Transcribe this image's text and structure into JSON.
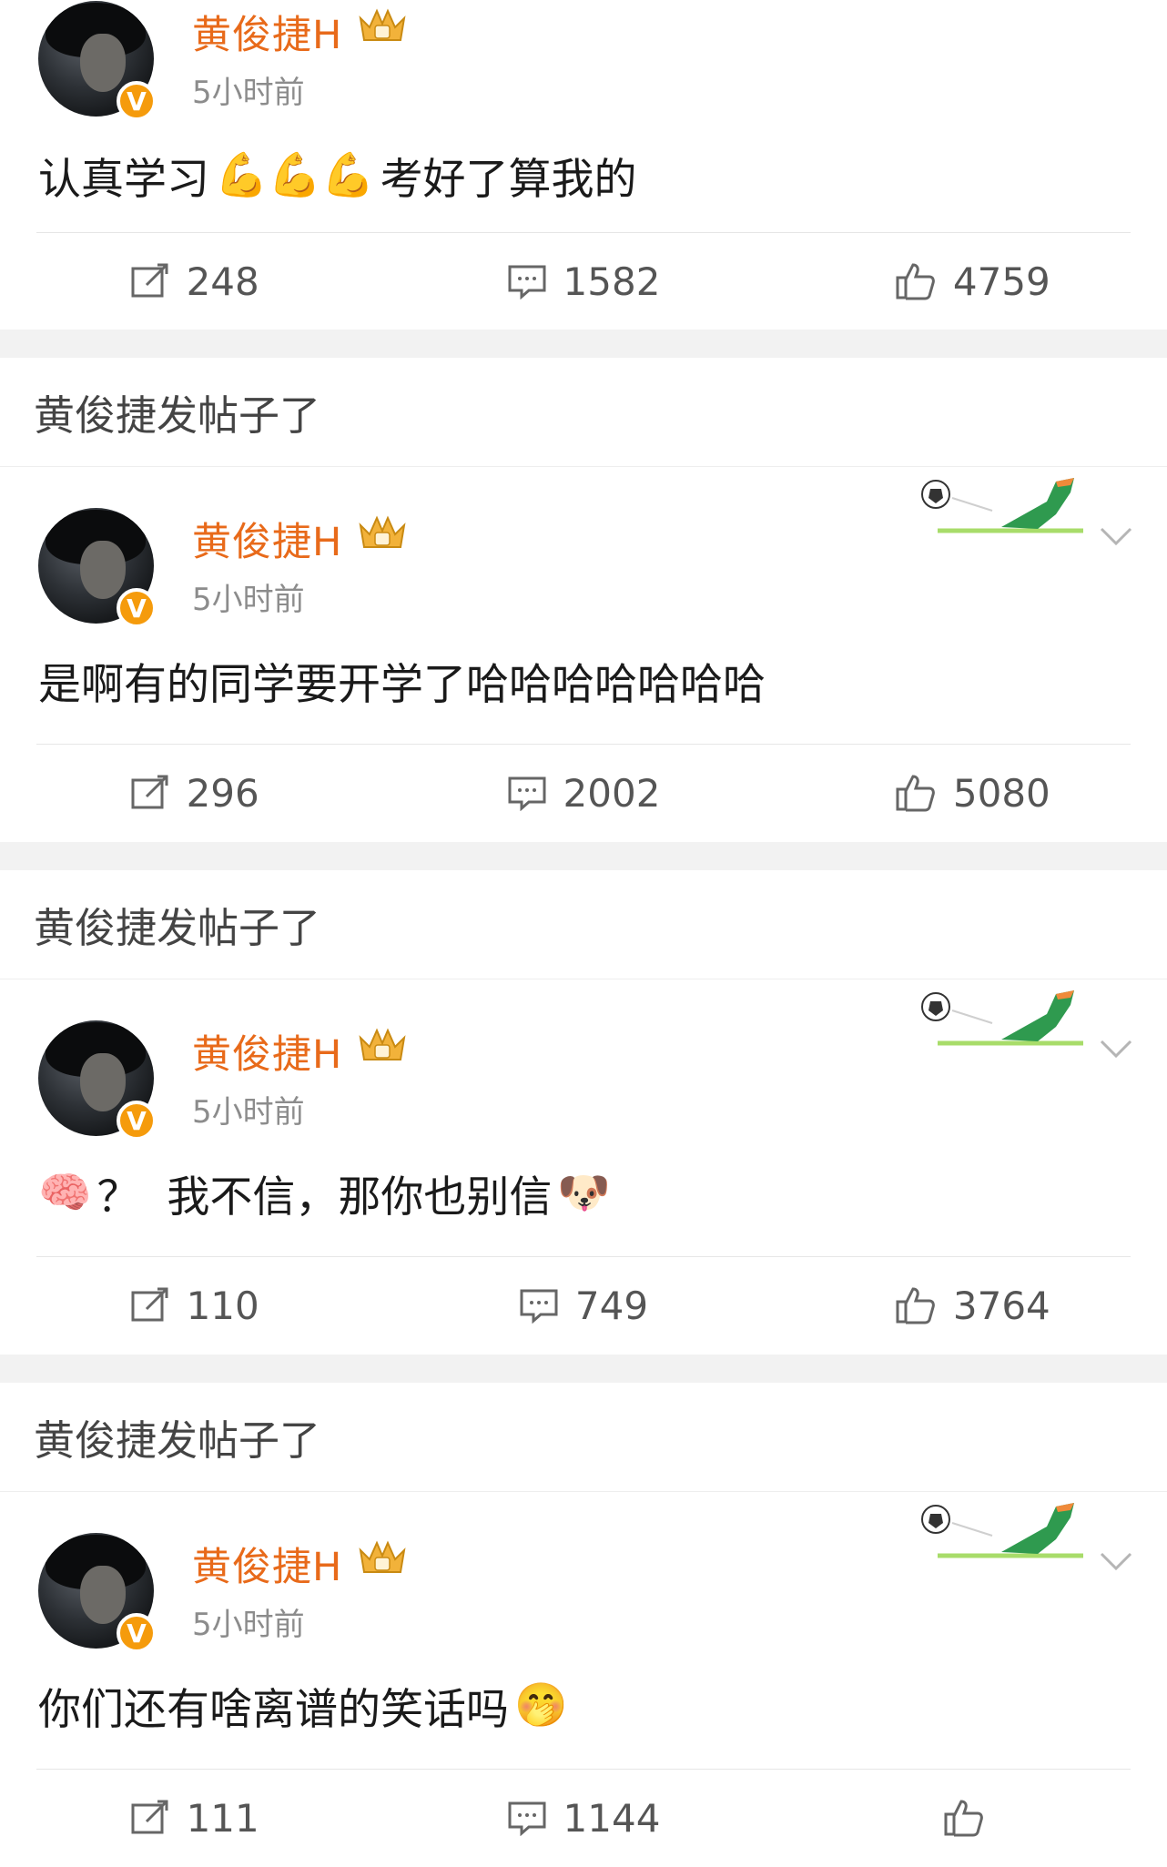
{
  "section_label": "黄俊捷发帖子了",
  "user": {
    "name": "黄俊捷H",
    "verified_mark": "V"
  },
  "posts": [
    {
      "time": "5小时前",
      "text_parts": [
        "认真学习",
        "💪💪💪",
        "考好了算我的"
      ],
      "reposts": "248",
      "comments": "1582",
      "likes": "4759"
    },
    {
      "time": "5小时前",
      "text_parts": [
        "是啊有的同学要开学了哈哈哈哈哈哈哈"
      ],
      "reposts": "296",
      "comments": "2002",
      "likes": "5080"
    },
    {
      "time": "5小时前",
      "text_parts": [
        "🧠",
        "？  我不信，那你也别信",
        "🐶"
      ],
      "reposts": "110",
      "comments": "749",
      "likes": "3764"
    },
    {
      "time": "5小时前",
      "text_parts": [
        "你们还有啥离谱的笑话吗",
        "🤭"
      ],
      "reposts": "111",
      "comments": "1144",
      "likes": ""
    }
  ],
  "colors": {
    "username": "#e86a1a",
    "badge": "#f59b0c",
    "separator": "#f2f2f2"
  },
  "icons": [
    "crown-badge-icon",
    "verified-badge-icon",
    "football-kick-icon",
    "chevron-down-icon",
    "repost-icon",
    "comment-icon",
    "like-icon"
  ]
}
